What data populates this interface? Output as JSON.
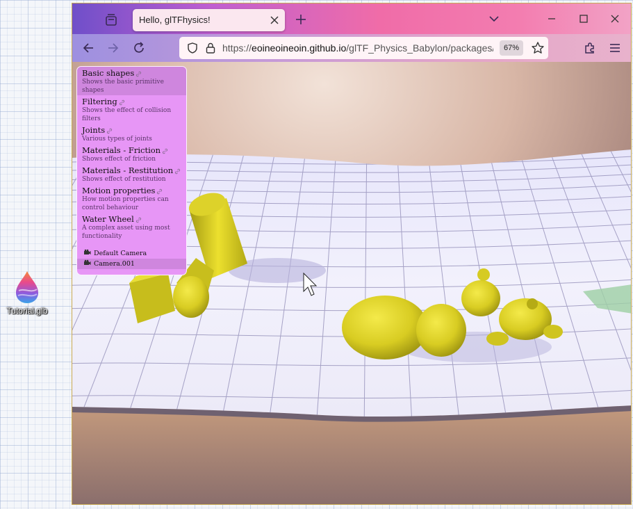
{
  "desktop": {
    "icon_label": "Tutorial.glb",
    "icon_name": "blender-file-icon"
  },
  "browser": {
    "tab_title": "Hello, glTFhysics!",
    "url_prefix": "https://",
    "url_host": "eoineoineoin.github.io",
    "url_path": "/glTF_Physics_Babylon/packages/d",
    "zoom": "67%"
  },
  "menu": {
    "samples": [
      {
        "name": "Basic shapes",
        "description": "Shows the basic primitive shapes"
      },
      {
        "name": "Filtering",
        "description": "Shows the effect of collision filters"
      },
      {
        "name": "Joints",
        "description": "Various types of joints"
      },
      {
        "name": "Materials - Friction",
        "description": "Shows effect of friction"
      },
      {
        "name": "Materials - Restitution",
        "description": "Shows effect of restitution"
      },
      {
        "name": "Motion properties",
        "description": "How motion properties can control behaviour"
      },
      {
        "name": "Water Wheel",
        "description": "A complex asset using most functionality"
      }
    ],
    "cameras": [
      "Default Camera",
      "Camera.001"
    ]
  },
  "colors": {
    "menu_bg": "#e796f6",
    "menu_active": "#cf86de",
    "object_yellow": "#e7dc2a"
  }
}
